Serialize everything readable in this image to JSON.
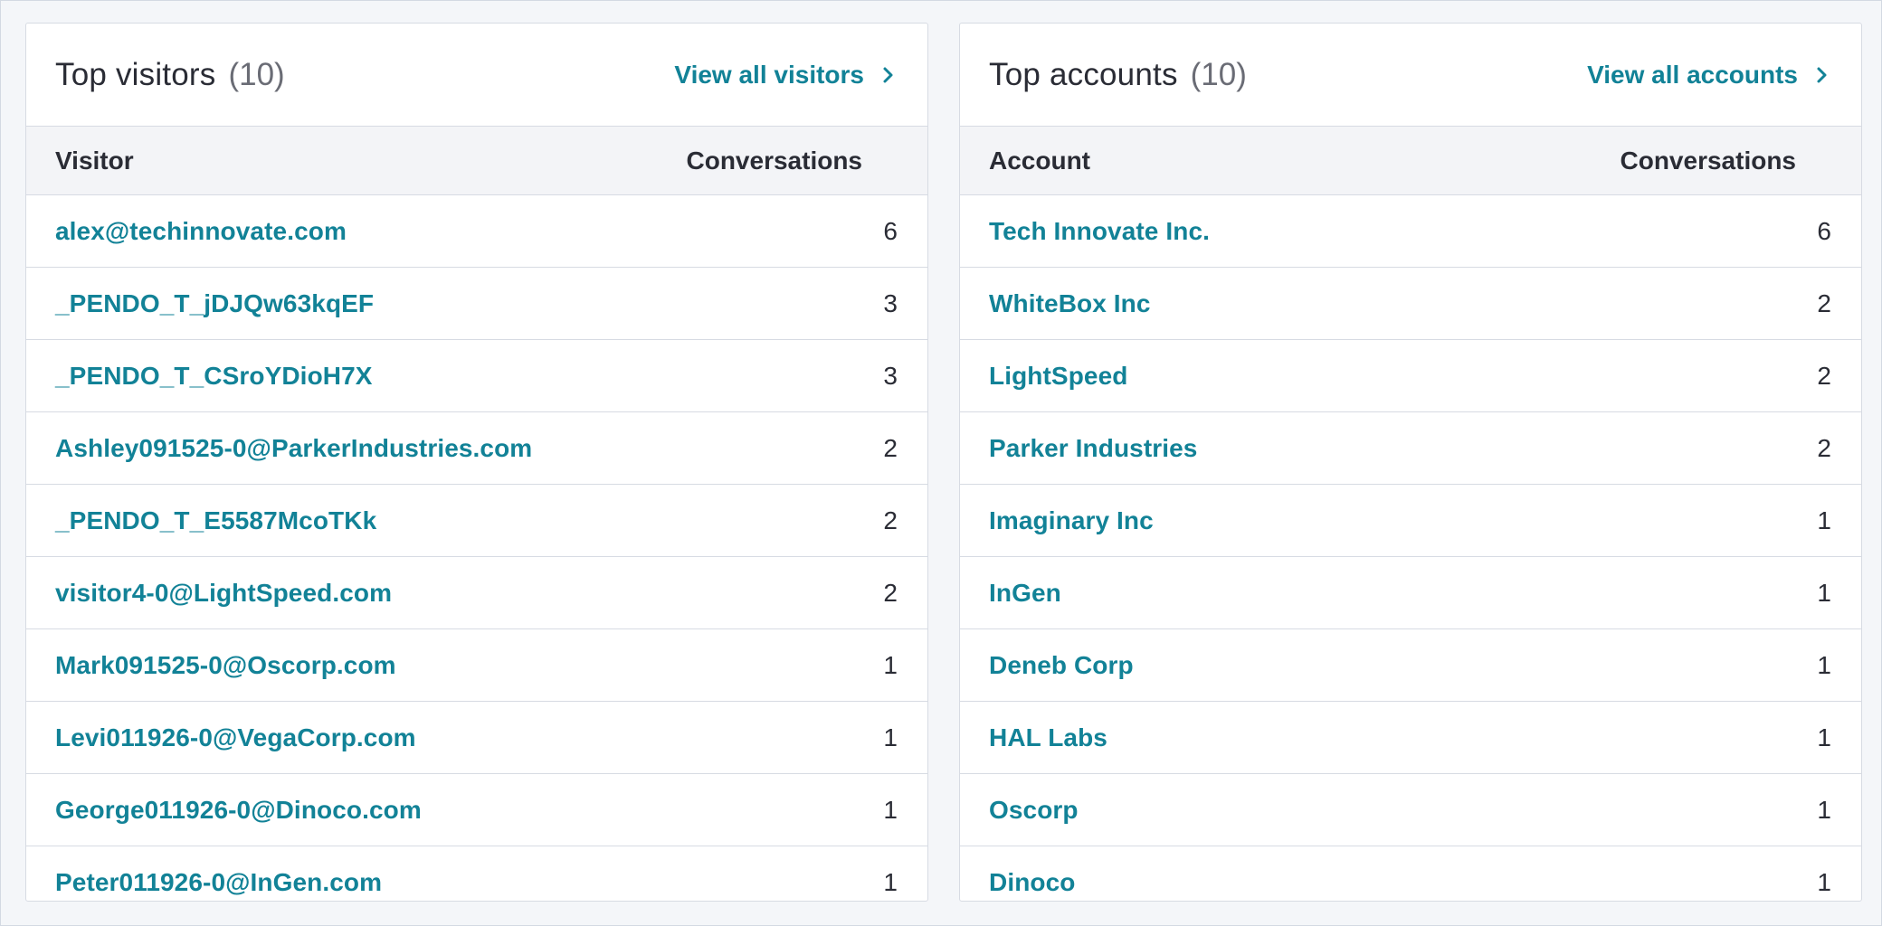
{
  "visitors_card": {
    "title": "Top visitors",
    "count": "(10)",
    "view_all_label": "View all visitors",
    "columns": [
      "Visitor",
      "Conversations"
    ],
    "rows": [
      {
        "name": "alex@techinnovate.com",
        "conversations": "6"
      },
      {
        "name": "_PENDO_T_jDJQw63kqEF",
        "conversations": "3"
      },
      {
        "name": "_PENDO_T_CSroYDioH7X",
        "conversations": "3"
      },
      {
        "name": "Ashley091525-0@ParkerIndustries.com",
        "conversations": "2"
      },
      {
        "name": "_PENDO_T_E5587McoTKk",
        "conversations": "2"
      },
      {
        "name": "visitor4-0@LightSpeed.com",
        "conversations": "2"
      },
      {
        "name": "Mark091525-0@Oscorp.com",
        "conversations": "1"
      },
      {
        "name": "Levi011926-0@VegaCorp.com",
        "conversations": "1"
      },
      {
        "name": "George011926-0@Dinoco.com",
        "conversations": "1"
      },
      {
        "name": "Peter011926-0@InGen.com",
        "conversations": "1"
      }
    ]
  },
  "accounts_card": {
    "title": "Top accounts",
    "count": "(10)",
    "view_all_label": "View all accounts",
    "columns": [
      "Account",
      "Conversations"
    ],
    "rows": [
      {
        "name": "Tech Innovate Inc.",
        "conversations": "6"
      },
      {
        "name": "WhiteBox Inc",
        "conversations": "2"
      },
      {
        "name": "LightSpeed",
        "conversations": "2"
      },
      {
        "name": "Parker Industries",
        "conversations": "2"
      },
      {
        "name": "Imaginary Inc",
        "conversations": "1"
      },
      {
        "name": "InGen",
        "conversations": "1"
      },
      {
        "name": "Deneb Corp",
        "conversations": "1"
      },
      {
        "name": "HAL Labs",
        "conversations": "1"
      },
      {
        "name": "Oscorp",
        "conversations": "1"
      },
      {
        "name": "Dinoco",
        "conversations": "1"
      }
    ]
  },
  "icons": {
    "view_all_chevron": "chevron-right-icon"
  },
  "colors": {
    "link": "#128297",
    "text": "#2a2c35",
    "muted": "#6a6c75",
    "header_bg": "#f3f4f7",
    "border": "#d7dbe3",
    "page_bg": "#f4f6f9"
  }
}
